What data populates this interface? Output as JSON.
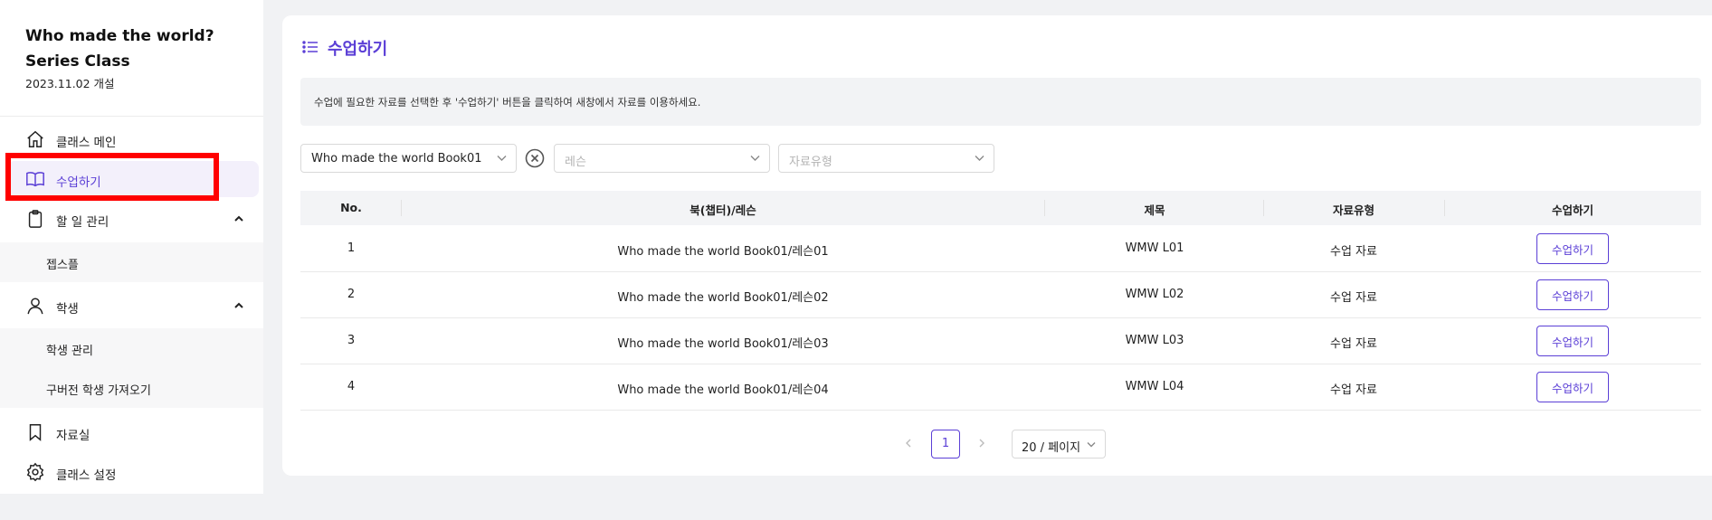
{
  "sidebar": {
    "class_title_line1": "Who made the world?",
    "class_title_line2": "Series Class",
    "class_date": "2023.11.02 개설",
    "items": [
      {
        "label": "클래스 메인",
        "icon": "home-icon"
      },
      {
        "label": "수업하기",
        "icon": "book-icon",
        "active": true
      },
      {
        "label": "할 일 관리",
        "icon": "clipboard-icon",
        "expanded": true
      },
      {
        "label": "젭스플"
      },
      {
        "label": "학생",
        "icon": "user-icon",
        "expanded": true
      },
      {
        "label": "학생 관리"
      },
      {
        "label": "구버전 학생 가져오기"
      },
      {
        "label": "자료실",
        "icon": "bookmark-icon"
      },
      {
        "label": "클래스 설정",
        "icon": "gear-icon"
      }
    ]
  },
  "main": {
    "title": "수업하기",
    "notice": "수업에 필요한 자료를 선택한 후 '수업하기' 버튼을 클릭하여 새창에서 자료를 이용하세요.",
    "filters": {
      "book_value": "Who made the world Book01",
      "lesson_placeholder": "레슨",
      "type_placeholder": "자료유형"
    },
    "table": {
      "headers": [
        "No.",
        "북(챕터)/레슨",
        "제목",
        "자료유형",
        "수업하기"
      ],
      "rows": [
        {
          "no": "1",
          "lesson": "Who made the world Book01/레슨01",
          "title": "WMW L01",
          "type": "수업 자료",
          "action": "수업하기"
        },
        {
          "no": "2",
          "lesson": "Who made the world Book01/레슨02",
          "title": "WMW L02",
          "type": "수업 자료",
          "action": "수업하기"
        },
        {
          "no": "3",
          "lesson": "Who made the world Book01/레슨03",
          "title": "WMW L03",
          "type": "수업 자료",
          "action": "수업하기"
        },
        {
          "no": "4",
          "lesson": "Who made the world Book01/레슨04",
          "title": "WMW L04",
          "type": "수업 자료",
          "action": "수업하기"
        }
      ]
    },
    "pagination": {
      "current_page": "1",
      "page_size": "20 / 페이지"
    }
  },
  "colors": {
    "accent": "#5b3fd6",
    "highlight": "#ff0000"
  }
}
